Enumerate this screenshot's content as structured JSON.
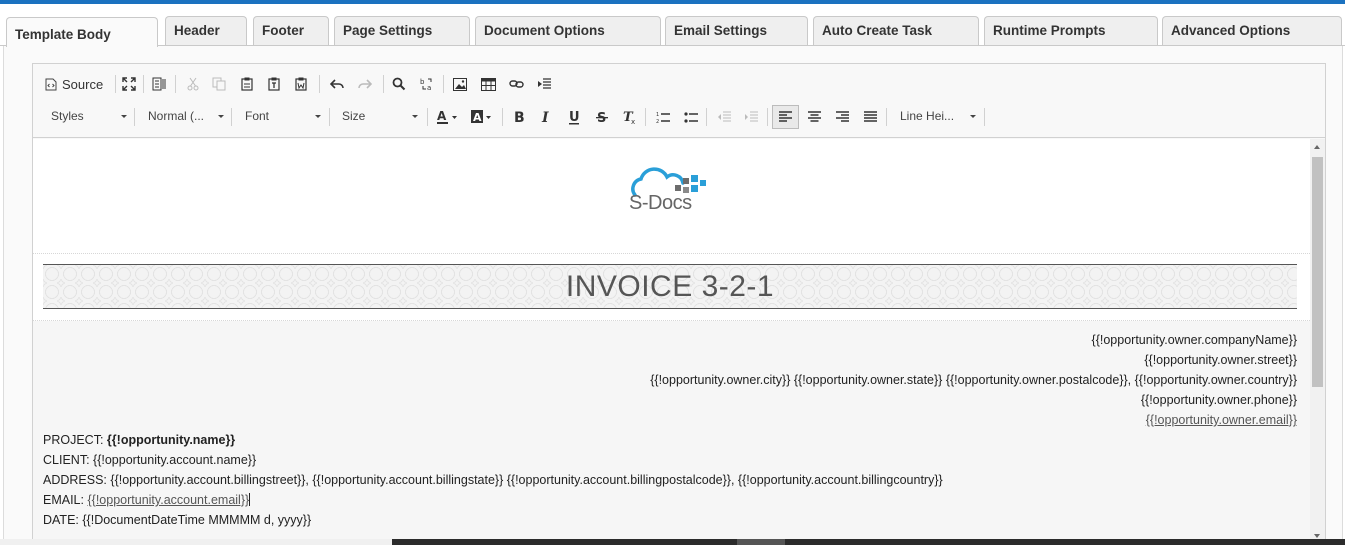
{
  "tabs": [
    {
      "label": "Template Body",
      "active": true
    },
    {
      "label": "Header"
    },
    {
      "label": "Footer"
    },
    {
      "label": "Page Settings"
    },
    {
      "label": "Document Options"
    },
    {
      "label": "Email Settings"
    },
    {
      "label": "Auto Create Task"
    },
    {
      "label": "Runtime Prompts"
    },
    {
      "label": "Advanced Options"
    }
  ],
  "toolbar": {
    "source_label": "Source",
    "styles_label": "Styles",
    "format_label": "Normal (...",
    "font_label": "Font",
    "size_label": "Size",
    "line_height_label": "Line Hei..."
  },
  "document": {
    "logo_text": "S-Docs",
    "title": "INVOICE 3-2-1",
    "owner_company": "{{!opportunity.owner.companyName}}",
    "owner_street": "{{!opportunity.owner.street}}",
    "owner_address_line": "{{!opportunity.owner.city}} {{!opportunity.owner.state}} {{!opportunity.owner.postalcode}}, {{!opportunity.owner.country}}",
    "owner_phone": "{{!opportunity.owner.phone}}",
    "owner_email": "{{!opportunity.owner.email}}",
    "project_label": "PROJECT:",
    "project_value": "{{!opportunity.name}}",
    "client_label": "CLIENT:",
    "client_value": "{{!opportunity.account.name}}",
    "address_label": "ADDRESS:",
    "address_value": "{{!opportunity.account.billingstreet}}, {{!opportunity.account.billingstate}} {{!opportunity.account.billingpostalcode}}, {{!opportunity.account.billingcountry}}",
    "email_label": "EMAIL:",
    "email_value": "{{!opportunity.account.email}}",
    "date_label": "DATE:",
    "date_value": "{{!DocumentDateTime MMMMM d, yyyy}}"
  },
  "colors": {
    "accent_blue": "#1b72c0",
    "logo_blue": "#2a9fd8",
    "logo_gray": "#6d6d6d"
  }
}
